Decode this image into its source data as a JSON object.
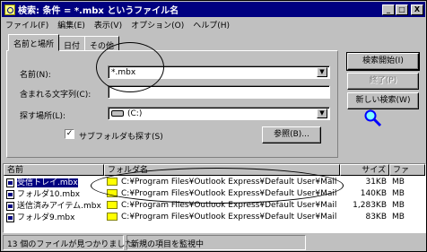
{
  "window": {
    "title": "検索: 条件 = *.mbx というファイル名",
    "controls": [
      "_",
      "□",
      "X"
    ]
  },
  "menu": [
    "ファイル(F)",
    "編集(E)",
    "表示(V)",
    "オプション(O)",
    "ヘルプ(H)"
  ],
  "tabs": [
    "名前と場所",
    "日付",
    "その他"
  ],
  "form": {
    "name_label": "名前(N):",
    "name_value": "*.mbx",
    "contains_label": "含まれる文字列(C):",
    "contains_value": "",
    "lookin_label": "探す場所(L):",
    "lookin_value": "(C:)",
    "subfolders_label": "サブフォルダも探す(S)",
    "subfolders_checked": "✓",
    "browse_label": "参照(B)..."
  },
  "buttons": {
    "find_now": "検索開始(I)",
    "stop": "終了(P)",
    "new_search": "新しい検索(W)"
  },
  "list": {
    "headers": [
      "名前",
      "フォルダ名",
      "サイズ",
      "ファ"
    ],
    "rows": [
      {
        "name": "受信トレイ.mbx",
        "folder": "C:¥Program Files¥Outlook Express¥Default User¥Mail",
        "size": "31KB",
        "type": "MB"
      },
      {
        "name": "フォルダ10.mbx",
        "folder": "C:¥Program Files¥Outlook Express¥Default User¥Mail",
        "size": "140KB",
        "type": "MB"
      },
      {
        "name": "送信済みアイテム.mbx",
        "folder": "C:¥Program Files¥Outlook Express¥Default User¥Mail",
        "size": "1,283KB",
        "type": "MB"
      },
      {
        "name": "フォルダ9.mbx",
        "folder": "C:¥Program Files¥Outlook Express¥Default User¥Mail",
        "size": "83KB",
        "type": "MB"
      }
    ]
  },
  "status": {
    "count": "13 個のファイルが見つかりました。",
    "monitor": "新規の項目を監視中"
  },
  "colors": {
    "titlebar": "#000080",
    "face": "#c0c0c0",
    "selection": "#000080"
  }
}
